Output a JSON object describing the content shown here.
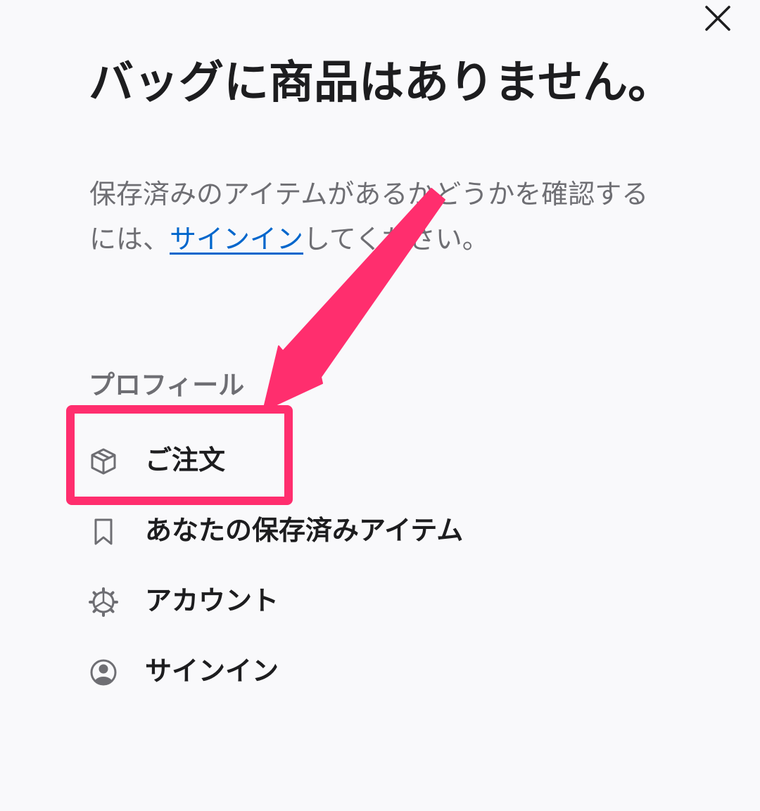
{
  "header": {
    "close_icon": "close-icon"
  },
  "bag": {
    "title": "バッグに商品はありません。",
    "message_before": "保存済みのアイテムがあるかどうかを確認するには、",
    "sign_in_link": "サインイン",
    "message_after": "してください。"
  },
  "profile": {
    "section_label": "プロフィール",
    "items": [
      {
        "label": "ご注文",
        "icon": "package-icon"
      },
      {
        "label": "あなたの保存済みアイテム",
        "icon": "bookmark-icon"
      },
      {
        "label": "アカウント",
        "icon": "gear-icon"
      },
      {
        "label": "サインイン",
        "icon": "user-circle-icon"
      }
    ]
  },
  "annotation": {
    "color": "#ff2e6e"
  }
}
